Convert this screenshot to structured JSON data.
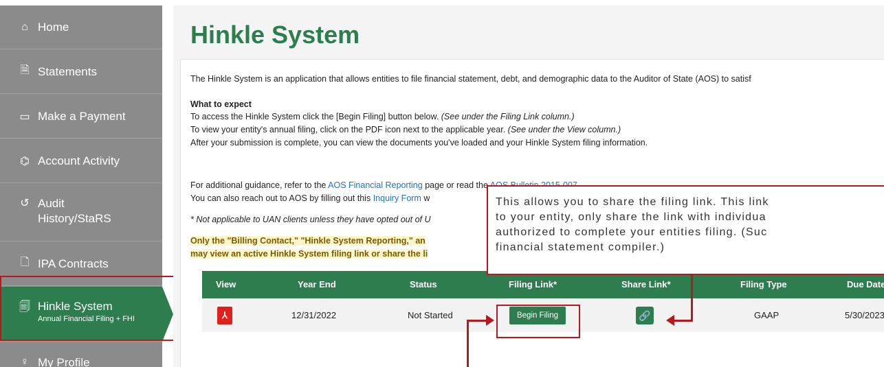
{
  "sidebar": {
    "items": [
      {
        "label": "Home",
        "icon": "home-icon",
        "glyph": "⌂"
      },
      {
        "label": "Statements",
        "icon": "document-icon",
        "glyph": "🗎"
      },
      {
        "label": "Make a Payment",
        "icon": "credit-card-icon",
        "glyph": "▭"
      },
      {
        "label": "Account Activity",
        "icon": "buildings-icon",
        "glyph": "⌬"
      },
      {
        "label": "Audit History/StaRS",
        "icon": "history-icon",
        "glyph": "↺"
      },
      {
        "label": "IPA Contracts",
        "icon": "contract-icon",
        "glyph": "🗋"
      },
      {
        "label": "Hinkle System",
        "icon": "report-icon",
        "glyph": "🗐",
        "sub": "Annual Financial Filing + FHI"
      },
      {
        "label": "My Profile",
        "icon": "user-icon",
        "glyph": "♀"
      }
    ]
  },
  "main": {
    "title": "Hinkle System",
    "intro": "The Hinkle System is an application that allows entities to file financial statement, debt, and demographic data to the Auditor of State (AOS) to satisf",
    "what_heading": "What to expect",
    "what1_a": "To access the Hinkle System click the [Begin Filing] button below. ",
    "what1_b": "(See under the Filing Link column.)",
    "what2_a": "To view your entity's annual filing, click on the PDF icon next to the applicable year. ",
    "what2_b": "(See under the View column.)",
    "what3": "After your submission is complete, you can view the documents you've loaded and your Hinkle System filing information.",
    "guid_a": "For additional guidance, refer to the ",
    "guid_link1": "AOS Financial Reporting",
    "guid_b": " page or read the ",
    "guid_link2": "AOS Bulletin 2015-007",
    "reach_a": "You can also reach out to AOS by filling out this ",
    "reach_link": "Inquiry Form",
    "reach_b": " w",
    "na_text": "* Not applicable to UAN clients unless they have opted out of U",
    "billing1": "Only the \"Billing Contact,\" \"Hinkle System Reporting,\" an",
    "billing2": "may view an active Hinkle System filing link or share the li"
  },
  "table": {
    "headers": [
      "View",
      "Year End",
      "Status",
      "Filing Link*",
      "Share Link*",
      "Filing Type",
      "Due Date"
    ],
    "row": {
      "year_end": "12/31/2022",
      "status": "Not Started",
      "filing_button": "Begin Filing",
      "filing_type": "GAAP",
      "due_date": "5/30/2023"
    }
  },
  "annotation": {
    "lines": [
      "This allows you to share the filing link. This link",
      "to your entity, only share the link with individua",
      "authorized to complete your entities filing. (Suc",
      "financial statement compiler.)"
    ]
  },
  "colors": {
    "brand_green": "#2e7d4f",
    "annotation_red": "#b3191f",
    "sidebar_gray": "#8b8b8b",
    "highlight_yellow": "#fff6cc",
    "link_blue": "#1a73c7"
  }
}
